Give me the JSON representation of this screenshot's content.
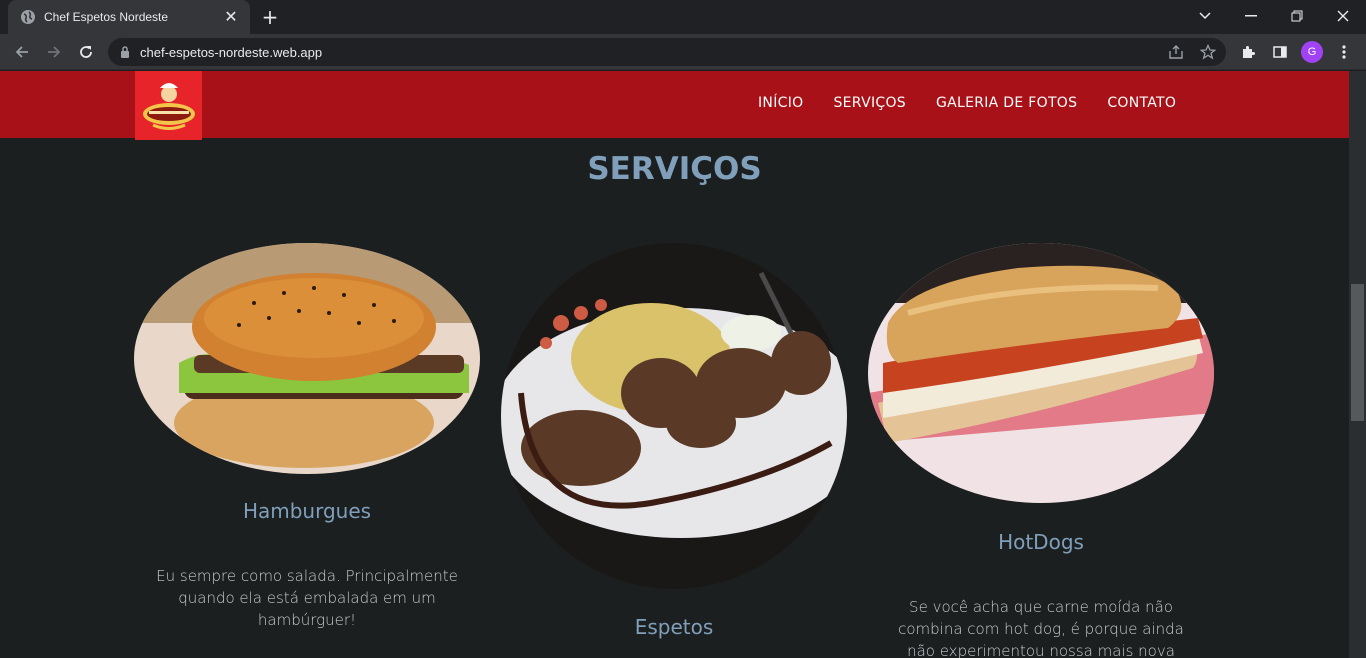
{
  "browser": {
    "tab_title": "Chef Espetos Nordeste",
    "url": "chef-espetos-nordeste.web.app",
    "profile_initial": "G"
  },
  "site": {
    "nav": [
      "INÍCIO",
      "SERVIÇOS",
      "GALERIA DE FOTOS",
      "CONTATO"
    ],
    "section_title": "SERVIÇOS",
    "cards": [
      {
        "title": "Hamburgues",
        "text": "Eu sempre como salada. Principalmente quando ela está embalada em um hambúrguer!"
      },
      {
        "title": "Espetos",
        "text": ""
      },
      {
        "title": "HotDogs",
        "text": "Se você acha que carne moída não combina com hot dog, é porque ainda não experimentou nossa mais nova opção!"
      }
    ]
  },
  "colors": {
    "header_red": "#a81117",
    "accent_blue": "#7f9fba",
    "page_bg": "#1c1f20"
  }
}
